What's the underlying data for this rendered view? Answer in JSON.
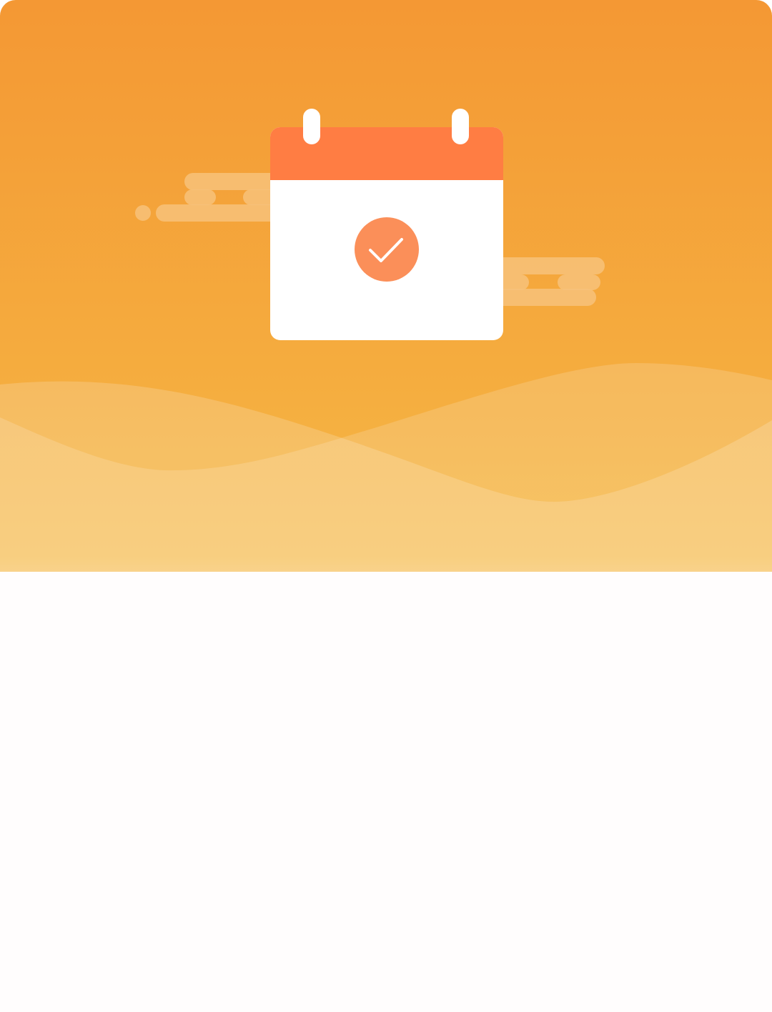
{
  "hero": {
    "icon": "calendar-check-icon",
    "gradient_top": "#f49834",
    "gradient_mid": "#f6b947",
    "calendar_header_color": "#ff7d43",
    "check_badge_color": "#fb8f59",
    "cloud_color": "#f7c27a"
  }
}
